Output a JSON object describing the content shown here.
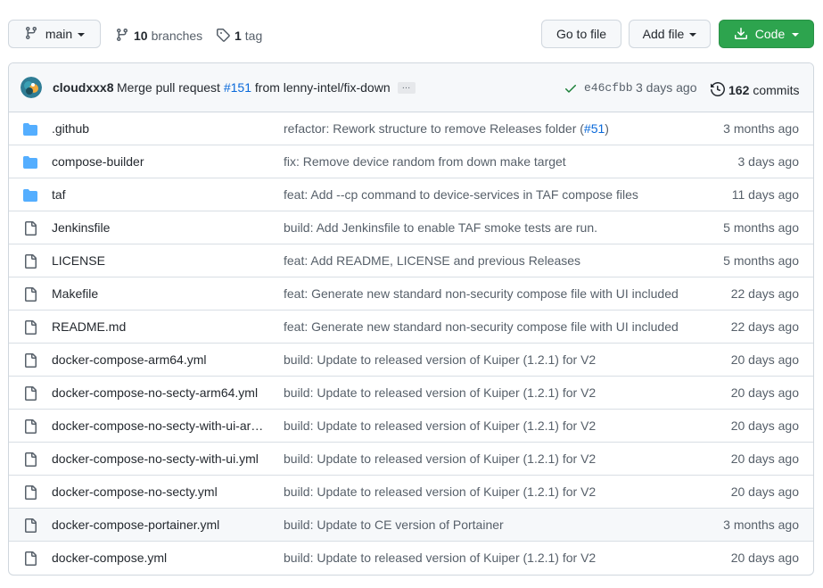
{
  "toolbar": {
    "branch_button_label": "main",
    "branches_count": "10",
    "branches_label": "branches",
    "tags_count": "1",
    "tags_label": "tag",
    "go_to_file_label": "Go to file",
    "add_file_label": "Add file",
    "code_label": "Code"
  },
  "latest_commit": {
    "author": "cloudxxx8",
    "message_prefix": "Merge pull request",
    "pr_number": "#151",
    "message_suffix": "from lenny-intel/fix-down",
    "ellipsis": "…",
    "sha": "e46cfbb",
    "time": "3 days ago",
    "commits_count": "162",
    "commits_label": "commits",
    "status": "success"
  },
  "colors": {
    "link": "#0969da",
    "folder": "#54aeff",
    "success": "#1a7f37",
    "green_button": "#2da44e"
  },
  "files": [
    {
      "type": "folder",
      "name": ".github",
      "message": "refactor: Rework structure to remove Releases folder (",
      "message_link": "#51",
      "message_tail": ")",
      "age": "3 months ago"
    },
    {
      "type": "folder",
      "name": "compose-builder",
      "message": "fix: Remove device random from down make target",
      "age": "3 days ago"
    },
    {
      "type": "folder",
      "name": "taf",
      "message": "feat: Add --cp command to device-services in TAF compose files",
      "age": "11 days ago"
    },
    {
      "type": "file",
      "name": "Jenkinsfile",
      "message": "build: Add Jenkinsfile to enable TAF smoke tests are run.",
      "age": "5 months ago"
    },
    {
      "type": "file",
      "name": "LICENSE",
      "message": "feat: Add README, LICENSE and previous Releases",
      "age": "5 months ago"
    },
    {
      "type": "file",
      "name": "Makefile",
      "message": "feat: Generate new standard non-security compose file with UI included",
      "age": "22 days ago"
    },
    {
      "type": "file",
      "name": "README.md",
      "message": "feat: Generate new standard non-security compose file with UI included",
      "age": "22 days ago"
    },
    {
      "type": "file",
      "name": "docker-compose-arm64.yml",
      "message": "build: Update to released version of Kuiper (1.2.1) for V2",
      "age": "20 days ago"
    },
    {
      "type": "file",
      "name": "docker-compose-no-secty-arm64.yml",
      "message": "build: Update to released version of Kuiper (1.2.1) for V2",
      "age": "20 days ago"
    },
    {
      "type": "file",
      "name": "docker-compose-no-secty-with-ui-ar…",
      "message": "build: Update to released version of Kuiper (1.2.1) for V2",
      "age": "20 days ago"
    },
    {
      "type": "file",
      "name": "docker-compose-no-secty-with-ui.yml",
      "message": "build: Update to released version of Kuiper (1.2.1) for V2",
      "age": "20 days ago"
    },
    {
      "type": "file",
      "name": "docker-compose-no-secty.yml",
      "message": "build: Update to released version of Kuiper (1.2.1) for V2",
      "age": "20 days ago"
    },
    {
      "type": "file",
      "name": "docker-compose-portainer.yml",
      "message": "build: Update to CE version of Portainer",
      "age": "3 months ago",
      "hover": true
    },
    {
      "type": "file",
      "name": "docker-compose.yml",
      "message": "build: Update to released version of Kuiper (1.2.1) for V2",
      "age": "20 days ago"
    }
  ]
}
